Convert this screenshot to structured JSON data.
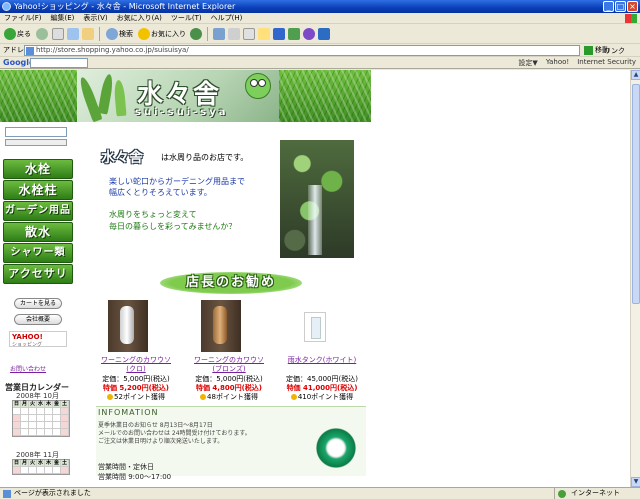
{
  "window": {
    "title": "Yahoo!ショッピング - 水々舎 - Microsoft Internet Explorer",
    "controls": [
      "_",
      "□",
      "×"
    ]
  },
  "menu": [
    "ファイル(F)",
    "編集(E)",
    "表示(V)",
    "お気に入り(A)",
    "ツール(T)",
    "ヘルプ(H)"
  ],
  "toolbar": {
    "back": "戻る",
    "search": "検索",
    "favorites": "お気に入り"
  },
  "address": {
    "label": "アドレス(D)",
    "url": "http://store.shopping.yahoo.co.jp/suisuisya/",
    "go": "移動",
    "links": "リンク"
  },
  "google": {
    "logo": "Google",
    "right_items": [
      "設定▼",
      "Yahoo!",
      "Internet Security"
    ]
  },
  "page": {
    "logo_title": "水々舎",
    "logo_subtitle": "sui-sui-sya",
    "nav": [
      "水栓",
      "水栓柱",
      "ガーデン用品",
      "散水",
      "シャワー類",
      "アクセサリ"
    ],
    "cart_button": "カートを見る",
    "company_button": "会社概要",
    "yahoo_badge_logo": "YAHOO!",
    "yahoo_badge_sub": "ショッピング",
    "contact_link": "お問い合わせ",
    "calendar": {
      "title": "営業日カレンダー",
      "month1": "2008年 10月",
      "month2": "2008年 11月",
      "weekdays": [
        "日",
        "月",
        "火",
        "水",
        "木",
        "金",
        "土"
      ]
    },
    "intro": {
      "logo": "水々舎",
      "line1": "は水周り品のお店です。",
      "line2": "楽しい蛇口からガーデニング用品まで",
      "line3": "幅広くとりそろえています。",
      "line4": "水周りをちょっと変えて",
      "line5": "毎日の暮らしを彩ってみませんか？"
    },
    "recommend_banner": "店長のお勧め",
    "products": [
      {
        "name": "ワーニングのカワウソ",
        "sub": "(クロ)",
        "price": "定価：5,000円(税込)",
        "sale": "特価 5,200円(税込)",
        "point": "52ポイント獲得"
      },
      {
        "name": "ワーニングのカワウソ",
        "sub": "(ブロンズ)",
        "price": "定価：5,000円(税込)",
        "sale": "特価 4,800円(税込)",
        "point": "48ポイント獲得"
      },
      {
        "name": "雨水タンク(ホワイト)",
        "sub": "",
        "price": "定価：45,000円(税込)",
        "sale": "特価 41,000円(税込)",
        "point": "410ポイント獲得"
      }
    ],
    "info": {
      "title": "INFOMATION",
      "line1": "夏季休業日のお知らせ 8月13日～8月17日",
      "line2": "メールでのお問い合わせは 24時間受け付けております。",
      "line3": "ご注文は休業日明けより順次発送いたします。"
    },
    "business_hours_title": "営業時間・定休日",
    "business_hours": "営業時間 9:00～17:00"
  },
  "status": {
    "text": "ページが表示されました",
    "zone": "インターネット"
  },
  "colors": {
    "nav_green": "#2e7d17",
    "link_purple": "#7a1fa0",
    "sale_red": "#dd0000"
  }
}
